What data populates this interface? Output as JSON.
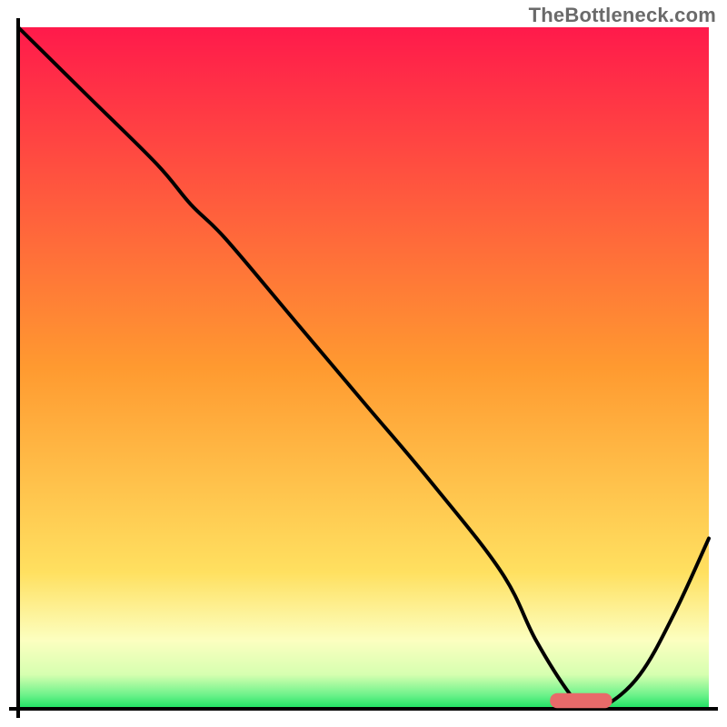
{
  "watermark": "TheBottleneck.com",
  "colors": {
    "gradient_top": "#ff1a4b",
    "gradient_mid1": "#ff7a2a",
    "gradient_mid2": "#ffd400",
    "gradient_low": "#fff7a0",
    "gradient_band": "#f5ffd0",
    "gradient_bottom": "#18e060",
    "curve": "#000000",
    "marker": "#e86a6a",
    "frame": "#000000"
  },
  "chart_data": {
    "type": "line",
    "title": "",
    "xlabel": "",
    "ylabel": "",
    "xlim": [
      0,
      100
    ],
    "ylim": [
      0,
      100
    ],
    "grid": false,
    "legend": false,
    "series": [
      {
        "name": "bottleneck-curve",
        "x": [
          0,
          10,
          20,
          25,
          30,
          40,
          50,
          60,
          70,
          75,
          80,
          82,
          85,
          90,
          95,
          100
        ],
        "y": [
          100,
          90,
          80,
          74,
          69,
          57,
          45,
          33,
          20,
          10,
          2,
          0.5,
          0.5,
          5,
          14,
          25
        ]
      }
    ],
    "marker": {
      "name": "target-range",
      "x_start": 77,
      "x_end": 86,
      "y": 1.2,
      "thickness": 2.2
    },
    "background_bands_y": [
      {
        "y": 0,
        "color": "#18e060"
      },
      {
        "y": 2,
        "color": "#6cf28a"
      },
      {
        "y": 5,
        "color": "#d6ffb0"
      },
      {
        "y": 10,
        "color": "#fcffc0"
      },
      {
        "y": 20,
        "color": "#ffe060"
      },
      {
        "y": 50,
        "color": "#ff9a30"
      },
      {
        "y": 100,
        "color": "#ff1a4b"
      }
    ]
  }
}
